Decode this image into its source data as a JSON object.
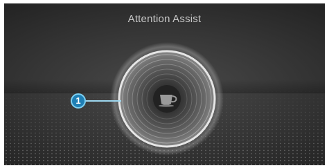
{
  "header": {
    "title": "Attention Assist"
  },
  "gauge": {
    "center_icon": "coffee-cup-icon"
  },
  "callout": {
    "number": "1"
  },
  "colors": {
    "background": "#2e2e2e",
    "title_text": "#c8c8c8",
    "callout_fill": "#1f7fb4",
    "callout_ring": "#7ed0f2"
  }
}
